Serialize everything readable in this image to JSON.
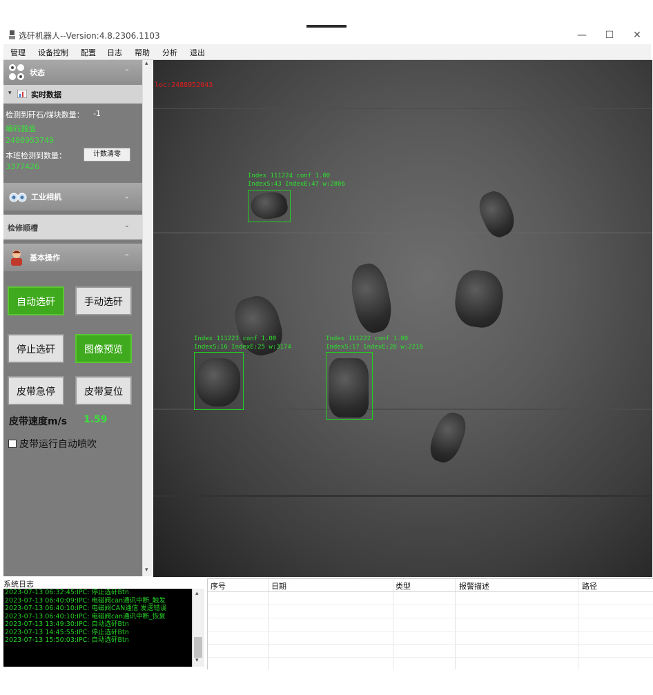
{
  "window": {
    "title": "选矸机器人--Version:4.8.2306.1103",
    "minimize": "—",
    "maximize": "☐",
    "close": "✕"
  },
  "menu": [
    "管理",
    "设备控制",
    "配置",
    "日志",
    "帮助",
    "分析",
    "退出"
  ],
  "sidebar": {
    "status_header": "状态",
    "realtime_header": "实时数据",
    "detect_label": "检测到矸石/煤块数量：",
    "detect_value": "-1",
    "encoder_label": "编码器值",
    "encoder_value": "2488953749",
    "shift_label": "本班检测到数量：",
    "shift_value": "3377426",
    "reset_button": "计数清零",
    "camera_header": "工业相机",
    "process_header": "检修顺槽",
    "basic_header": "基本操作",
    "buttons": {
      "auto_pick": "自动选矸",
      "manual_pick": "手动选矸",
      "stop_pick": "停止选矸",
      "image_preview": "图像预览",
      "belt_estop": "皮带急停",
      "belt_reset": "皮带复位"
    },
    "belt_speed_label": "皮带速度m/s",
    "belt_speed_value": "1.59",
    "auto_blow_label": "皮带运行自动喷吹"
  },
  "camera": {
    "loc_text": "loc:2488952043",
    "detections": [
      {
        "line1": "Index 111224 conf 1.00",
        "line2": "IndexS:43 IndexE:47 w:2806"
      },
      {
        "line1": "Index 111223 conf 1.00",
        "line2": "IndexS:16 IndexE:25 w:3174"
      },
      {
        "line1": "Index 111222 conf 1.00",
        "line2": "IndexS:17 IndexE:26 w:2216"
      }
    ]
  },
  "log": {
    "title": "系统日志",
    "lines": [
      "2023-07-13 06:32:45:IPC: 停止选矸Btn",
      "2023-07-13 06:40:09:IPC: 电磁阀can通讯中断_触发",
      "2023-07-13 06:40:10:IPC: 电磁阀CAN通信 发送错误",
      "2023-07-13 06:40:10:IPC: 电磁阀can通讯中断_恢复",
      "2023-07-13 13:49:30:IPC: 自动选矸Btn",
      "2023-07-13 14:45:55:IPC: 停止选矸Btn",
      "2023-07-13 15:50:03:IPC: 自动选矸Btn"
    ]
  },
  "table": {
    "headers": [
      "序号",
      "日期",
      "类型",
      "报警描述",
      "路径"
    ]
  }
}
